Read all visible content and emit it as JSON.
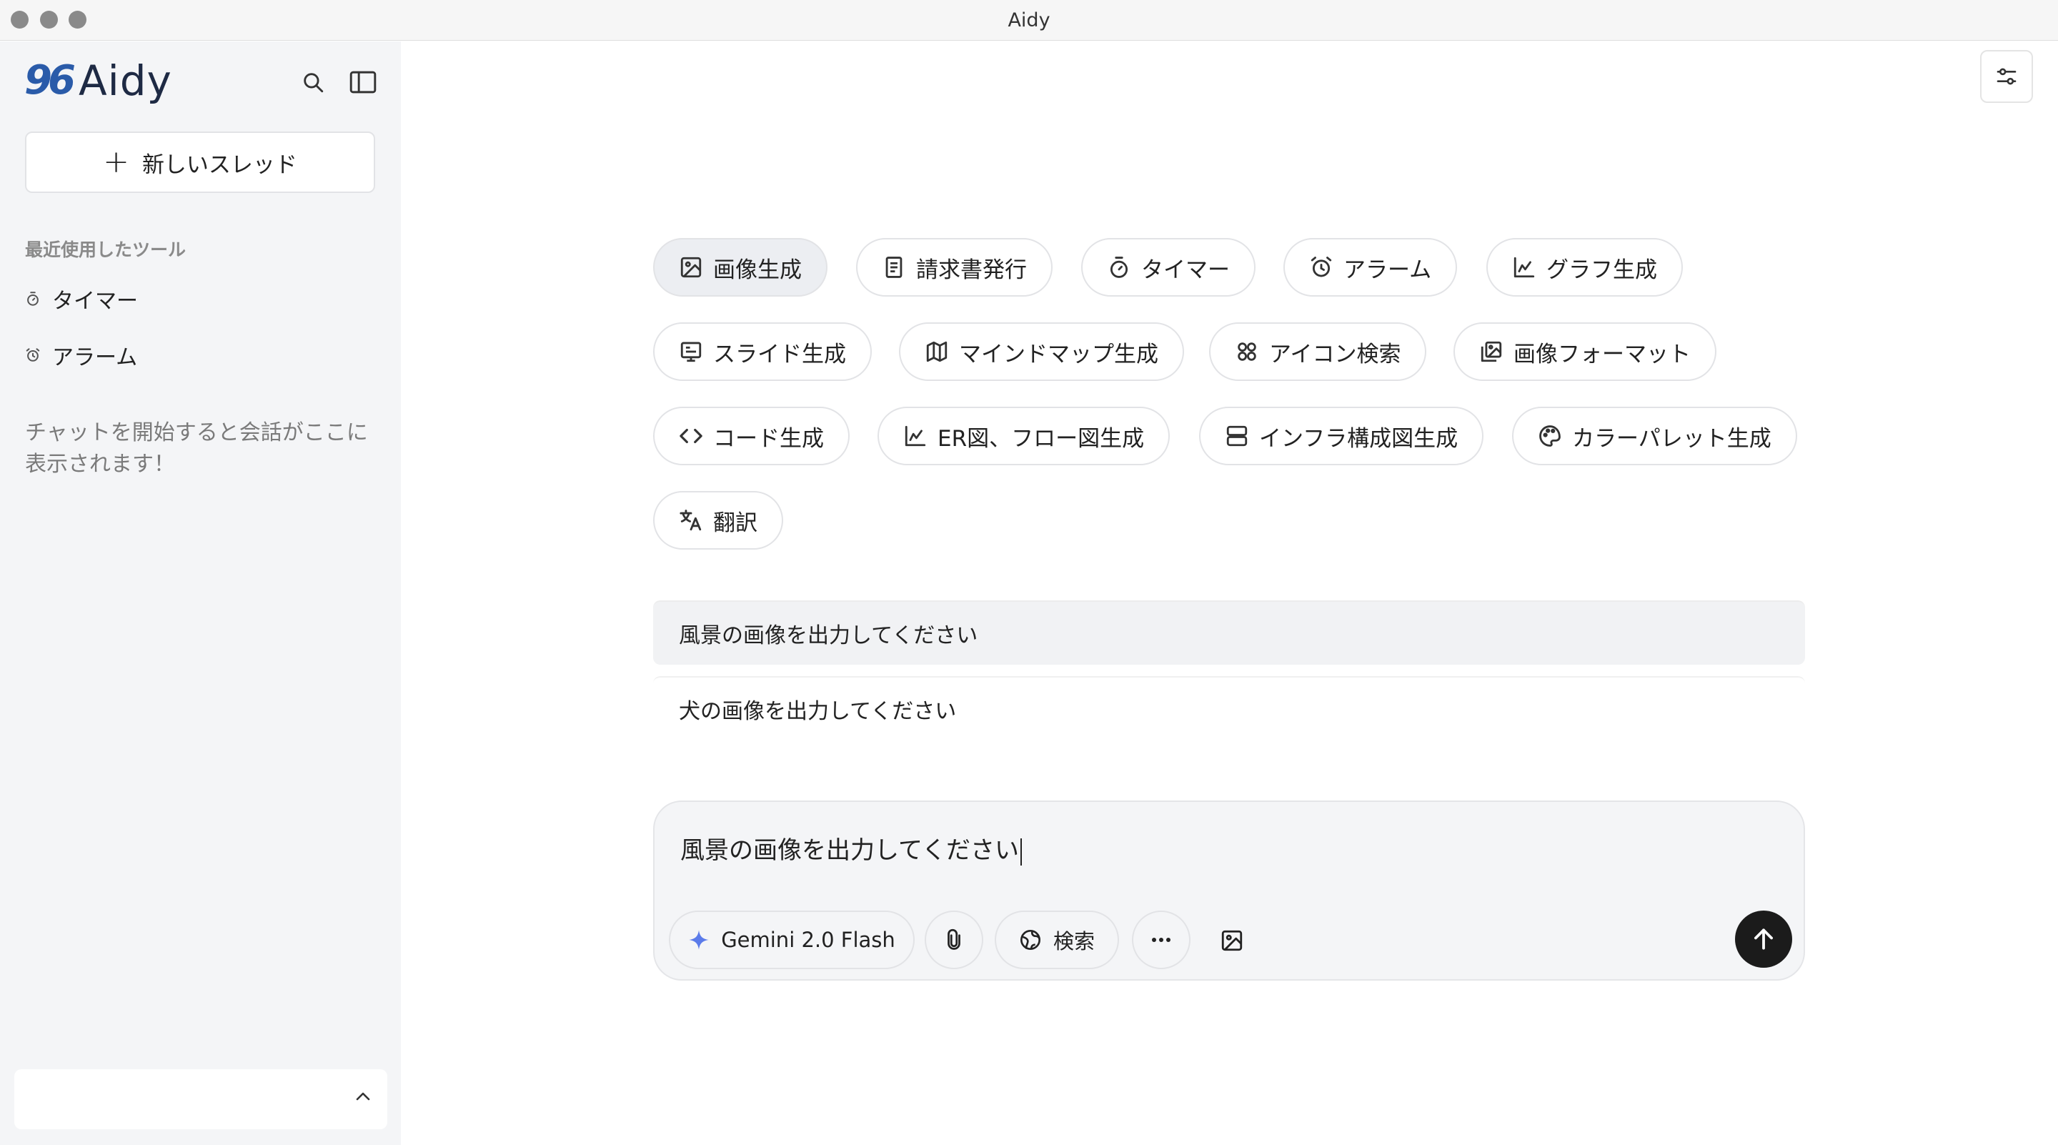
{
  "window": {
    "title": "Aidy"
  },
  "sidebar": {
    "logo_mark": "96",
    "logo_text": "Aidy",
    "new_thread_label": "新しいスレッド",
    "recent_title": "最近使用したツール",
    "recent_items": [
      {
        "label": "タイマー",
        "icon": "timer-icon"
      },
      {
        "label": "アラーム",
        "icon": "alarm-icon"
      }
    ],
    "empty_note": "チャットを開始すると会話がここに表示されます！"
  },
  "tools": [
    {
      "label": "画像生成",
      "icon": "image-icon",
      "active": true
    },
    {
      "label": "請求書発行",
      "icon": "document-icon"
    },
    {
      "label": "タイマー",
      "icon": "timer-icon"
    },
    {
      "label": "アラーム",
      "icon": "alarm-icon"
    },
    {
      "label": "グラフ生成",
      "icon": "chart-icon"
    },
    {
      "label": "スライド生成",
      "icon": "slides-icon"
    },
    {
      "label": "マインドマップ生成",
      "icon": "map-icon"
    },
    {
      "label": "アイコン検索",
      "icon": "icon-search-icon"
    },
    {
      "label": "画像フォーマット",
      "icon": "images-icon"
    },
    {
      "label": "コード生成",
      "icon": "code-icon"
    },
    {
      "label": "ER図、フロー図生成",
      "icon": "chart-icon"
    },
    {
      "label": "インフラ構成図生成",
      "icon": "server-icon"
    },
    {
      "label": "カラーパレット生成",
      "icon": "palette-icon"
    },
    {
      "label": "翻訳",
      "icon": "translate-icon"
    }
  ],
  "suggestions": [
    "風景の画像を出力してください",
    "犬の画像を出力してください"
  ],
  "composer": {
    "value": "風景の画像を出力してください",
    "model_label": "Gemini 2.0 Flash",
    "search_label": "検索",
    "accent": "#5b7bea"
  }
}
